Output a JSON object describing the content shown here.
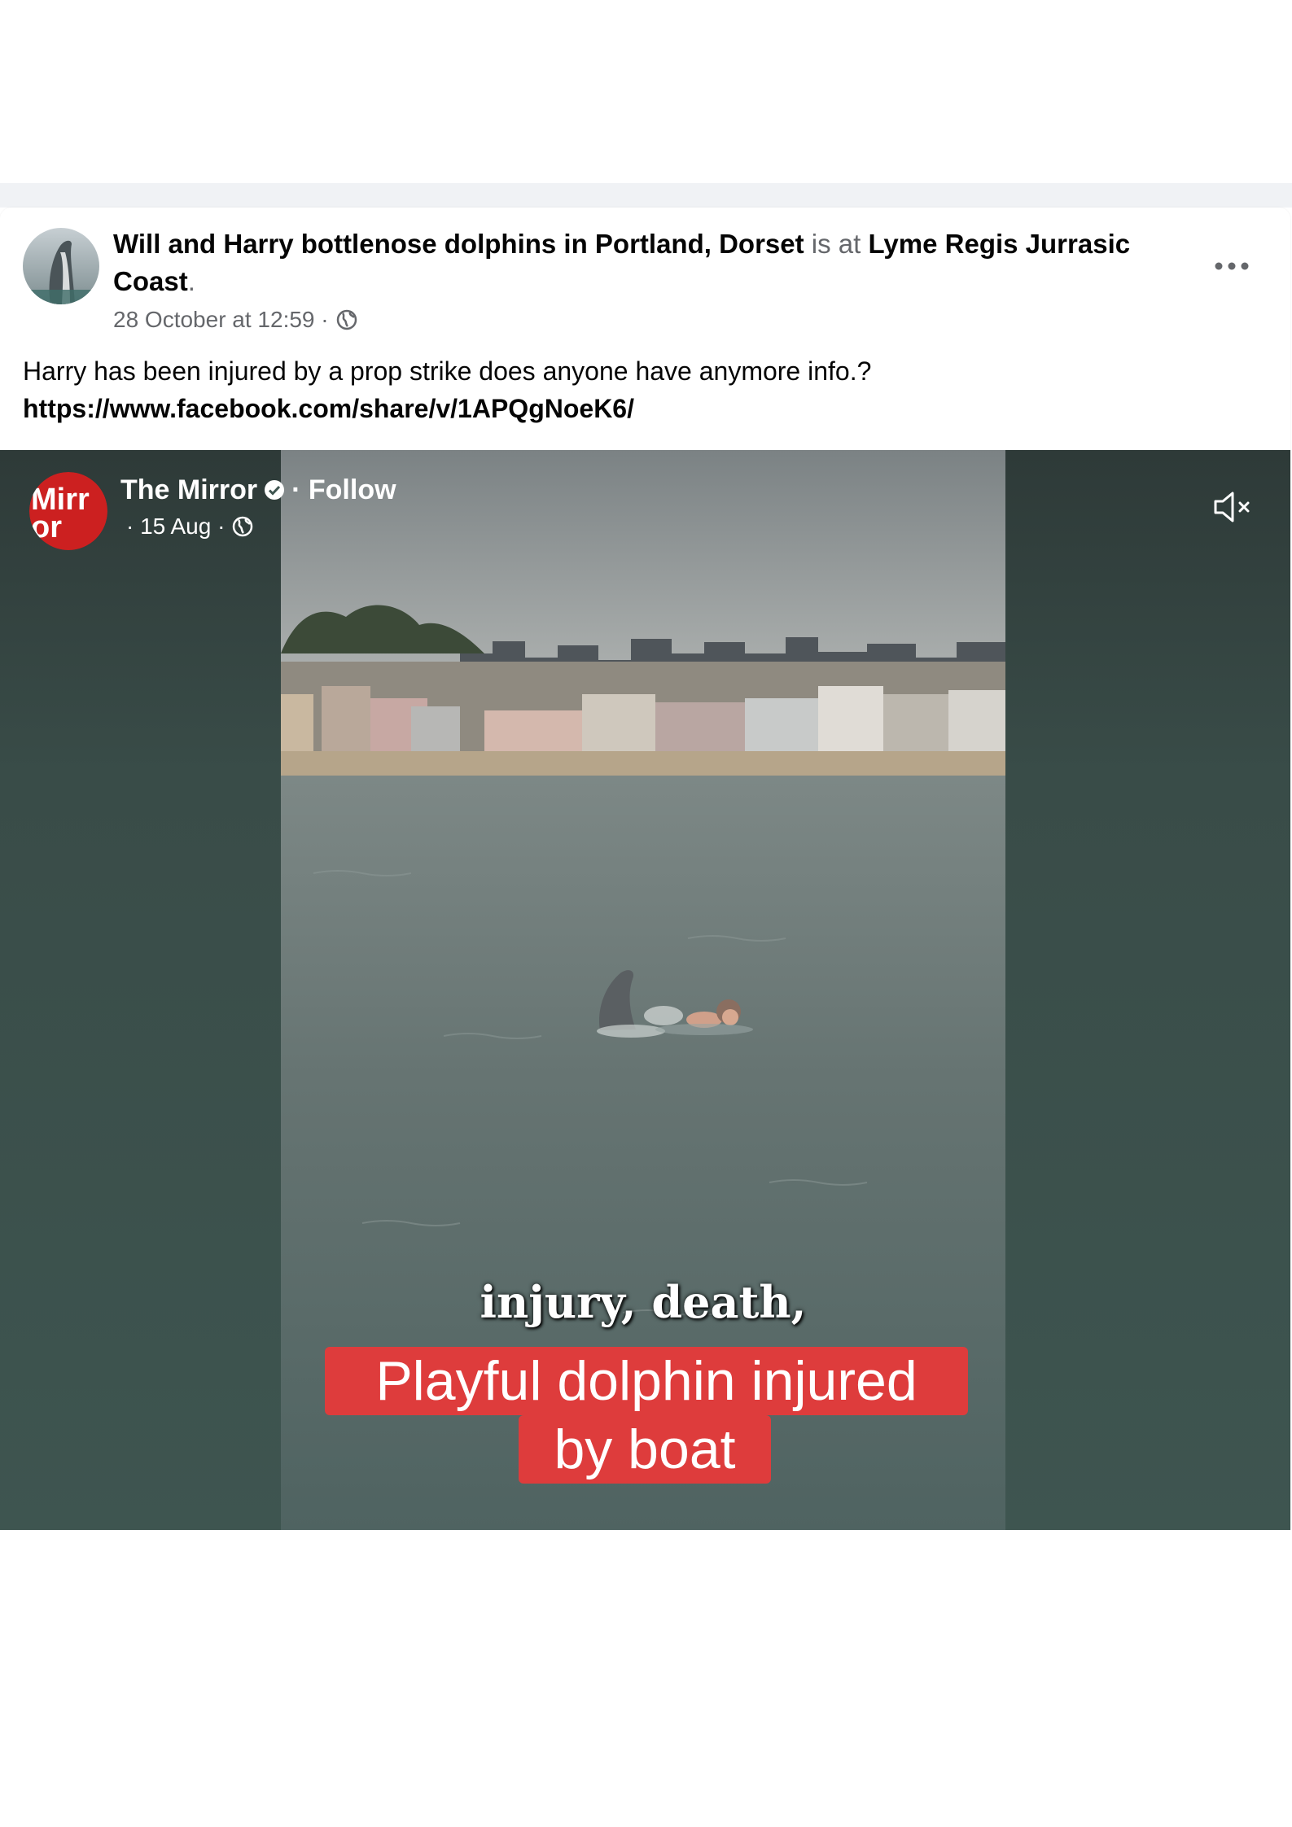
{
  "post": {
    "author": "Will and Harry bottlenose dolphins in Portland, Dorset",
    "is_at": "is at",
    "location": "Lyme Regis Jurrasic Coast",
    "period": ".",
    "timestamp": "28 October at 12:59 ·",
    "audience_icon": "globe-icon",
    "more_icon": "more-options-icon",
    "body_text": "Harry  has been injured by a prop strike does anyone have anymore info.?",
    "link": "https://www.facebook.com/share/v/1APQgNoeK6/"
  },
  "video": {
    "source_name": "The Mirror",
    "verified_icon": "verified-badge-icon",
    "follow_label": "· Follow",
    "date": "· 15 Aug ·",
    "audience_icon": "globe-icon",
    "mute_icon": "muted-speaker-icon",
    "subtitle": "injury, death,",
    "caption_line_1": "Playful dolphin injured",
    "caption_line_2": "by boat",
    "logo_text_top": "Mirr",
    "logo_text_bottom": "or"
  },
  "colors": {
    "caption_background": "#de3c3c",
    "mirror_red": "#cc2020",
    "video_side_background": "#3e5550"
  }
}
